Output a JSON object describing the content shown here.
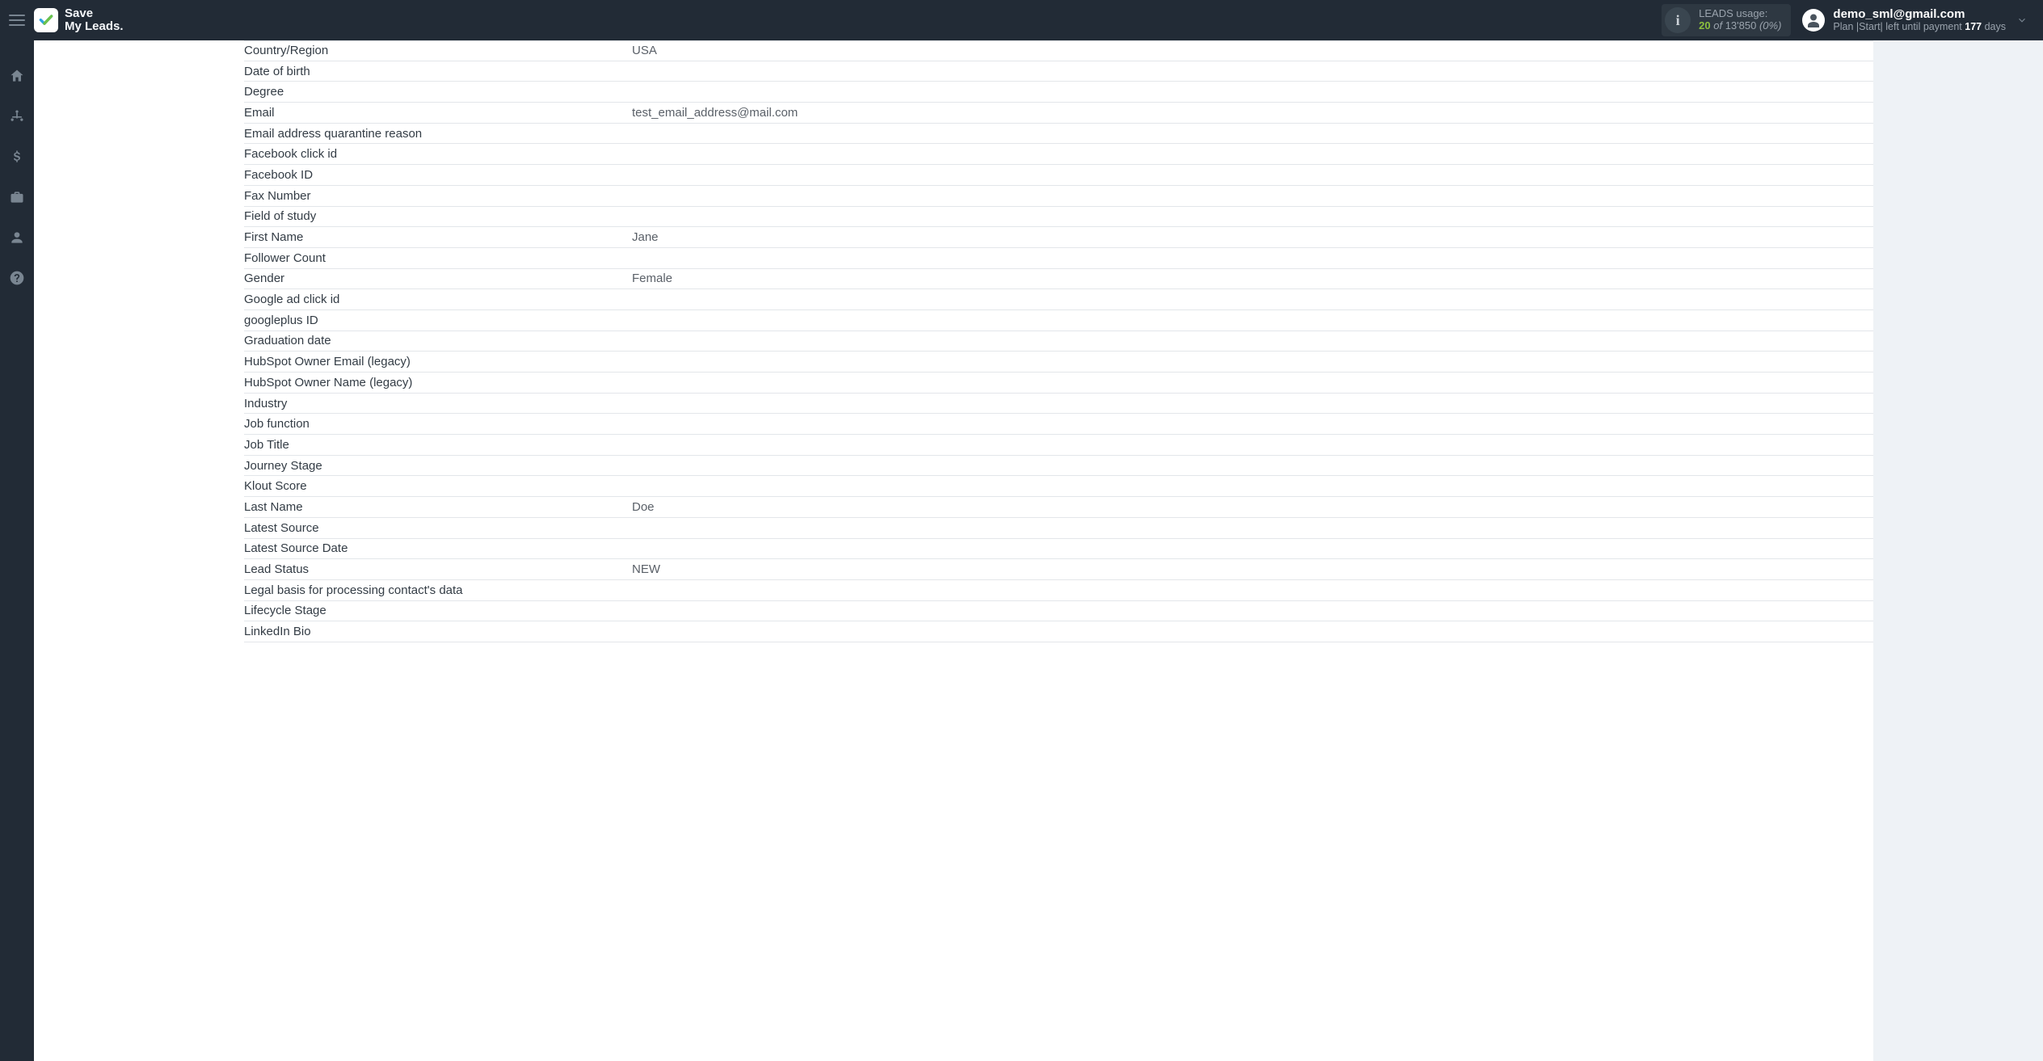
{
  "brand": {
    "line1": "Save",
    "line2": "My Leads."
  },
  "usage": {
    "title": "LEADS usage:",
    "count": "20",
    "of": "of",
    "limit": "13'850",
    "pct": "(0%)"
  },
  "user": {
    "email": "demo_sml@gmail.com",
    "plan_prefix": "Plan |Start| left until payment",
    "days_num": "177",
    "days_suffix": "days"
  },
  "fields": [
    {
      "label": "Country/Region",
      "value": "USA"
    },
    {
      "label": "Date of birth",
      "value": ""
    },
    {
      "label": "Degree",
      "value": ""
    },
    {
      "label": "Email",
      "value": "test_email_address@mail.com"
    },
    {
      "label": "Email address quarantine reason",
      "value": ""
    },
    {
      "label": "Facebook click id",
      "value": ""
    },
    {
      "label": "Facebook ID",
      "value": ""
    },
    {
      "label": "Fax Number",
      "value": ""
    },
    {
      "label": "Field of study",
      "value": ""
    },
    {
      "label": "First Name",
      "value": "Jane"
    },
    {
      "label": "Follower Count",
      "value": ""
    },
    {
      "label": "Gender",
      "value": "Female"
    },
    {
      "label": "Google ad click id",
      "value": ""
    },
    {
      "label": "googleplus ID",
      "value": ""
    },
    {
      "label": "Graduation date",
      "value": ""
    },
    {
      "label": "HubSpot Owner Email (legacy)",
      "value": ""
    },
    {
      "label": "HubSpot Owner Name (legacy)",
      "value": ""
    },
    {
      "label": "Industry",
      "value": ""
    },
    {
      "label": "Job function",
      "value": ""
    },
    {
      "label": "Job Title",
      "value": ""
    },
    {
      "label": "Journey Stage",
      "value": ""
    },
    {
      "label": "Klout Score",
      "value": ""
    },
    {
      "label": "Last Name",
      "value": "Doe"
    },
    {
      "label": "Latest Source",
      "value": ""
    },
    {
      "label": "Latest Source Date",
      "value": ""
    },
    {
      "label": "Lead Status",
      "value": "NEW"
    },
    {
      "label": "Legal basis for processing contact's data",
      "value": ""
    },
    {
      "label": "Lifecycle Stage",
      "value": ""
    },
    {
      "label": "LinkedIn Bio",
      "value": ""
    }
  ]
}
